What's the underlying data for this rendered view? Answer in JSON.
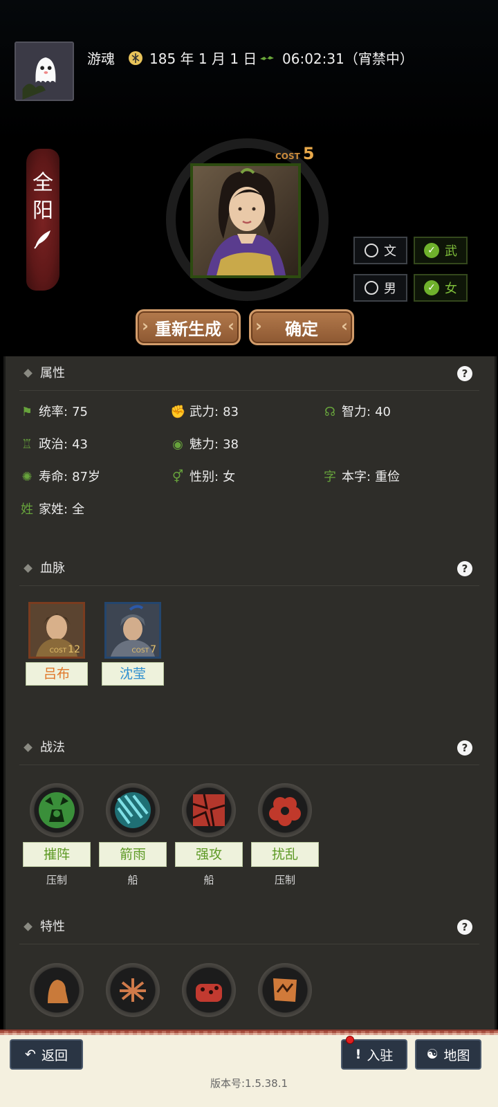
{
  "header": {
    "username": "游魂",
    "date": "185 年 1 月 1 日",
    "time": "06:02:31（宵禁中）"
  },
  "character": {
    "name_chars": [
      "全",
      "阳"
    ],
    "cost_label": "COST",
    "cost_value": "5"
  },
  "toggles": {
    "wen": {
      "label": "文",
      "checked": false
    },
    "wu": {
      "label": "武",
      "checked": true
    },
    "male": {
      "label": "男",
      "checked": false
    },
    "female": {
      "label": "女",
      "checked": true
    }
  },
  "actions": {
    "regenerate": "重新生成",
    "confirm": "确定"
  },
  "sections": {
    "attributes": "属性",
    "lineage": "血脉",
    "tactics": "战法",
    "traits": "特性"
  },
  "attributes": [
    {
      "label": "统率:",
      "value": "75",
      "icon": "flag-icon"
    },
    {
      "label": "武力:",
      "value": "83",
      "icon": "strength-icon"
    },
    {
      "label": "智力:",
      "value": "40",
      "icon": "brain-icon"
    },
    {
      "label": "政治:",
      "value": "43",
      "icon": "politics-icon"
    },
    {
      "label": "魅力:",
      "value": "38",
      "icon": "eye-icon"
    },
    {
      "label": "寿命:",
      "value": "87岁",
      "icon": "lifespan-icon"
    },
    {
      "label": "性别:",
      "value": "女",
      "icon": "gender-icon"
    },
    {
      "label": "本字:",
      "value": "重俭",
      "icon_text": "字"
    },
    {
      "label": "家姓:",
      "value": "全",
      "icon_text": "姓"
    }
  ],
  "lineage": [
    {
      "name": "吕布",
      "cost_label": "COST",
      "cost": "12",
      "name_color": "#e0782a"
    },
    {
      "name": "沈莹",
      "cost_label": "COST",
      "cost": "7",
      "name_color": "#2f8fd0"
    }
  ],
  "tactics": [
    {
      "name": "摧阵",
      "type": "压制",
      "icon": "break-formation-icon"
    },
    {
      "name": "箭雨",
      "type": "船",
      "icon": "arrow-rain-icon"
    },
    {
      "name": "强攻",
      "type": "船",
      "icon": "assault-icon"
    },
    {
      "name": "扰乱",
      "type": "压制",
      "icon": "disrupt-icon"
    }
  ],
  "traits": [
    "trait-1-icon",
    "trait-2-icon",
    "trait-3-icon",
    "trait-4-icon"
  ],
  "nav": {
    "back": "返回",
    "garrison": "入驻",
    "map": "地图",
    "version": "版本号:1.5.38.1"
  },
  "colors": {
    "accent_green": "#67a33c",
    "panel_bg": "#2e2d29",
    "button_brown": "#9c663d",
    "banner_red": "#6b1c1c"
  }
}
